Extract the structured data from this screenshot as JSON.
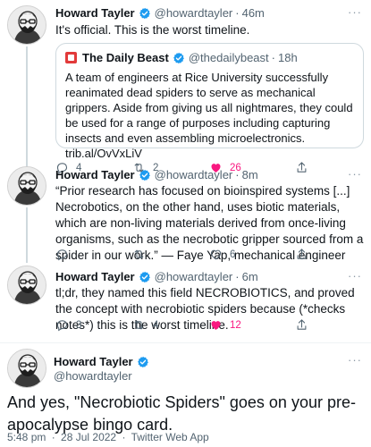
{
  "tweets": [
    {
      "name": "Howard Tayler",
      "handle": "@howardtayler",
      "time": "46m",
      "text": "It's official. This is the worst timeline.",
      "quote": {
        "name": "The Daily Beast",
        "handle": "@thedailybeast",
        "time": "18h",
        "text": "A team of engineers at Rice University successfully reanimated dead spiders to serve as mechanical grippers. Aside from giving us all nightmares, they could be used for a range of purposes including capturing insects and even assembling microelectronics. trib.al/OvVxLiV"
      },
      "replies": "4",
      "retweets": "2",
      "likes": "26"
    },
    {
      "name": "Howard Tayler",
      "handle": "@howardtayler",
      "time": "8m",
      "text": "“Prior research has focused on bioinspired systems [...] Necrobotics, on the other hand, uses biotic materials, which are non-living materials derived from once-living organisms, such as the necrobotic gripper sourced from a spider in our work.” — Faye Yap, mechanical engineer",
      "replies": "",
      "retweets": "",
      "likes": "6"
    },
    {
      "name": "Howard Tayler",
      "handle": "@howardtayler",
      "time": "6m",
      "text": "tl;dr, they named this field NECROBIOTICS, and proved the concept with necrobiotic spiders because (*checks notes*) this is the worst timeline.",
      "replies": "3",
      "retweets": "4",
      "likes": "12"
    }
  ],
  "main_tweet": {
    "name": "Howard Tayler",
    "handle": "@howardtayler",
    "text": "And yes, \"Necrobiotic Spiders\" goes on your pre-apocalypse bingo card.",
    "time": "5:48 pm",
    "date": "28 Jul 2022",
    "app": "Twitter Web App"
  },
  "more_glyph": "···",
  "meta_sep": "·",
  "colors": {
    "like": "#f91880",
    "verified": "#1d9bf0",
    "text": "#0f1419",
    "muted": "#536471"
  }
}
